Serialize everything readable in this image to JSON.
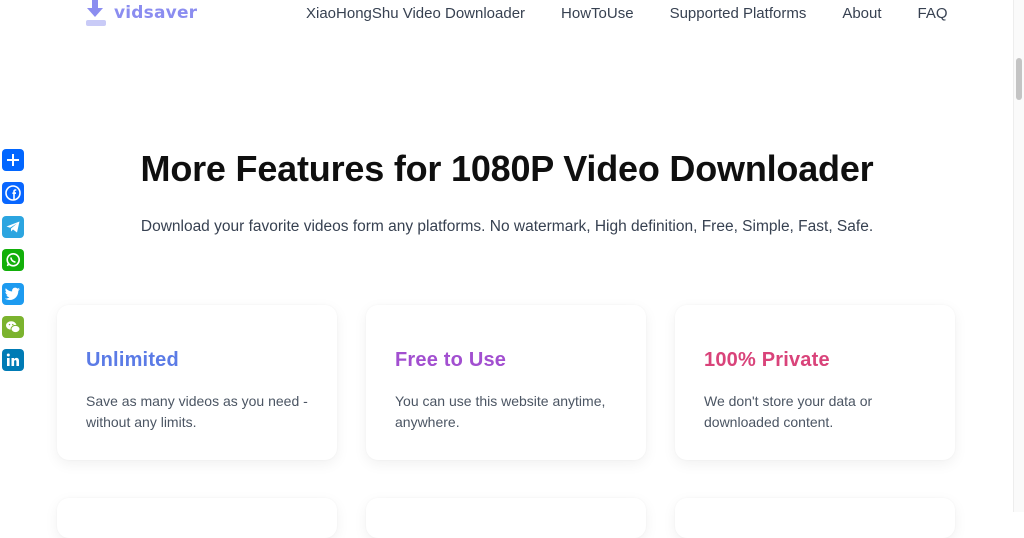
{
  "header": {
    "logo_text": "vidsaver",
    "nav": [
      {
        "label": "XiaoHongShu Video Downloader"
      },
      {
        "label": "HowToUse"
      },
      {
        "label": "Supported Platforms"
      },
      {
        "label": "About"
      },
      {
        "label": "FAQ"
      }
    ]
  },
  "share_bar": [
    {
      "icon": "share-plus-icon",
      "glyph": "+",
      "color": "#0166ff"
    },
    {
      "icon": "facebook-icon",
      "glyph": "f",
      "color": "#0866ff"
    },
    {
      "icon": "telegram-icon",
      "glyph": "➤",
      "color": "#2ca5e0"
    },
    {
      "icon": "whatsapp-icon",
      "glyph": "✆",
      "color": "#12af0a"
    },
    {
      "icon": "twitter-icon",
      "glyph": "t",
      "color": "#1d9bf0"
    },
    {
      "icon": "wechat-icon",
      "glyph": "✉",
      "color": "#7bb32e"
    },
    {
      "icon": "linkedin-icon",
      "glyph": "in",
      "color": "#007bb5"
    }
  ],
  "hero": {
    "title": "More Features for 1080P Video Downloader",
    "subtitle": "Download your favorite videos form any platforms. No watermark, High definition, Free, Simple, Fast, Safe."
  },
  "features": [
    {
      "title": "Unlimited",
      "text": "Save as many videos as you need - without any limits.",
      "color": "#5b7be6"
    },
    {
      "title": "Free to Use",
      "text": "You can use this website anytime, anywhere.",
      "color": "#a24fd0"
    },
    {
      "title": "100% Private",
      "text": "We don't store your data or downloaded content.",
      "color": "#d9437a"
    }
  ]
}
